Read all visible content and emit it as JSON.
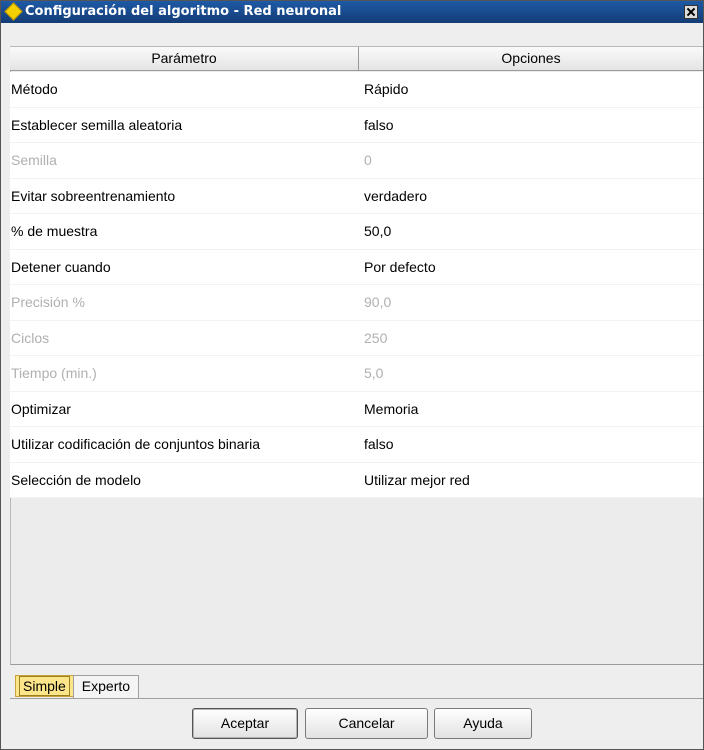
{
  "window": {
    "title": "Configuración del algoritmo - Red neuronal"
  },
  "table": {
    "headers": {
      "parameter": "Parámetro",
      "options": "Opciones"
    },
    "rows": [
      {
        "parameter": "Método",
        "value": "Rápido",
        "enabled": true
      },
      {
        "parameter": "Establecer semilla aleatoria",
        "value": "falso",
        "enabled": true
      },
      {
        "parameter": "Semilla",
        "value": "0",
        "enabled": false
      },
      {
        "parameter": "Evitar sobreentrenamiento",
        "value": "verdadero",
        "enabled": true
      },
      {
        "parameter": "% de muestra",
        "value": "50,0",
        "enabled": true
      },
      {
        "parameter": "Detener cuando",
        "value": "Por defecto",
        "enabled": true
      },
      {
        "parameter": "Precisión %",
        "value": "90,0",
        "enabled": false
      },
      {
        "parameter": "Ciclos",
        "value": "250",
        "enabled": false
      },
      {
        "parameter": "Tiempo (min.)",
        "value": "5,0",
        "enabled": false
      },
      {
        "parameter": "Optimizar",
        "value": "Memoria",
        "enabled": true
      },
      {
        "parameter": "Utilizar codificación de conjuntos binaria",
        "value": "falso",
        "enabled": true
      },
      {
        "parameter": "Selección de modelo",
        "value": "Utilizar mejor red",
        "enabled": true
      }
    ]
  },
  "tabs": [
    {
      "label": "Simple",
      "active": true
    },
    {
      "label": "Experto",
      "active": false
    }
  ],
  "buttons": {
    "ok": "Aceptar",
    "cancel": "Cancelar",
    "help": "Ayuda"
  },
  "colors": {
    "title_bar": "#143c75",
    "active_tab": "#fde68a",
    "disabled_text": "#b0b0b0"
  },
  "icons": {
    "title": "diamond-icon",
    "close": "close-icon"
  }
}
